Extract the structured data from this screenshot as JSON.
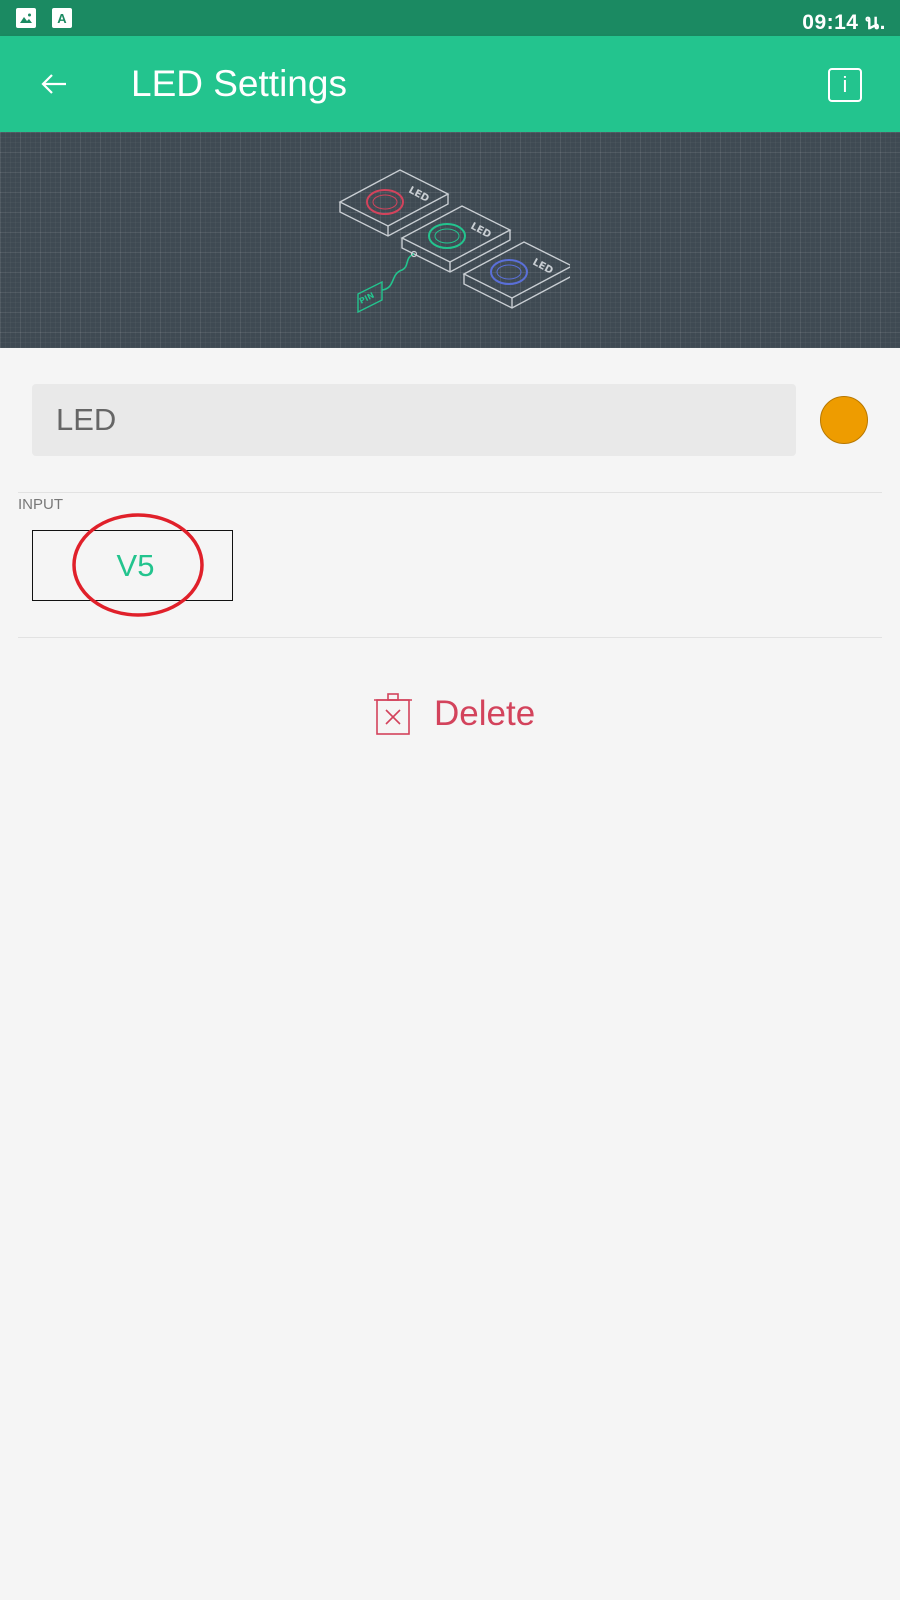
{
  "status_bar": {
    "time": "09:14 น.",
    "icons": [
      "image-icon",
      "keyboard-a-icon"
    ],
    "color": "#1b8a62"
  },
  "app_bar": {
    "title": "LED Settings",
    "back_icon": "arrow-left-icon",
    "info_icon": "info-icon",
    "info_glyph": "i",
    "color": "#23c48e"
  },
  "hero": {
    "illustration": "three-leds-with-pin",
    "led_labels": [
      "LED",
      "LED",
      "LED"
    ],
    "pin_label": "PIN",
    "led_colors": [
      "#d3435c",
      "#23c48e",
      "#5a6fd8"
    ]
  },
  "widget": {
    "name_value": "LED",
    "color": "#ee9c00"
  },
  "input": {
    "label": "INPUT",
    "pin": "V5",
    "highlight_color": "#e0202a"
  },
  "actions": {
    "delete_label": "Delete",
    "delete_icon": "trash-icon",
    "delete_color": "#d3435c"
  }
}
